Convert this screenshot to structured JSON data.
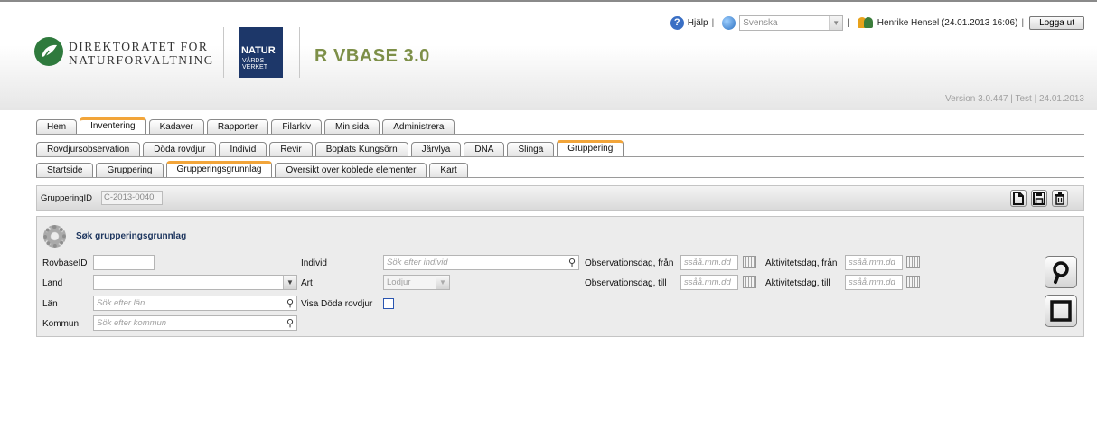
{
  "header": {
    "dn_logo_text": [
      "DIREKTORATET FOR",
      "NATURFORVALTNING"
    ],
    "nv_logo_text": [
      "NATUR",
      "VÅRDS",
      "VERKET"
    ],
    "app_title": "R VBASE 3.0",
    "help_label": "Hjälp",
    "separator": "|",
    "language_value": "Svenska",
    "user_info": "Henrike Hensel (24.01.2013 16:06)",
    "logout_label": "Logga ut",
    "version": "Version 3.0.447 | Test | 24.01.2013"
  },
  "tabs_main": [
    "Hem",
    "Inventering",
    "Kadaver",
    "Rapporter",
    "Filarkiv",
    "Min sida",
    "Administrera"
  ],
  "tabs_sub": [
    "Rovdjursobservation",
    "Döda rovdjur",
    "Individ",
    "Revir",
    "Boplats Kungsörn",
    "Järvlya",
    "DNA",
    "Slinga",
    "Gruppering"
  ],
  "tabs_sub2": [
    "Startside",
    "Gruppering",
    "Grupperingsgrunnlag",
    "Oversikt over koblede elementer",
    "Kart"
  ],
  "active_tabs": {
    "main": "Inventering",
    "sub": "Gruppering",
    "sub2": "Grupperingsgrunnlag"
  },
  "id_bar": {
    "label": "GrupperingID",
    "value": "C-2013-0040"
  },
  "search": {
    "title": "Søk grupperingsgrunnlag",
    "rovbaseid_label": "RovbaseID",
    "rovbaseid_value": "",
    "land_label": "Land",
    "land_value": "",
    "lan_label": "Län",
    "lan_placeholder": "Sök efter län",
    "kommun_label": "Kommun",
    "kommun_placeholder": "Sök efter kommun",
    "individ_label": "Individ",
    "individ_placeholder": "Sök efter individ",
    "art_label": "Art",
    "art_value": "Lodjur",
    "visa_doda_label": "Visa Döda rovdjur",
    "obs_fran_label": "Observationsdag, från",
    "obs_till_label": "Observationsdag, till",
    "akt_fran_label": "Aktivitetsdag, från",
    "akt_till_label": "Aktivitetsdag, till",
    "date_placeholder": "ssåå.mm.dd"
  }
}
